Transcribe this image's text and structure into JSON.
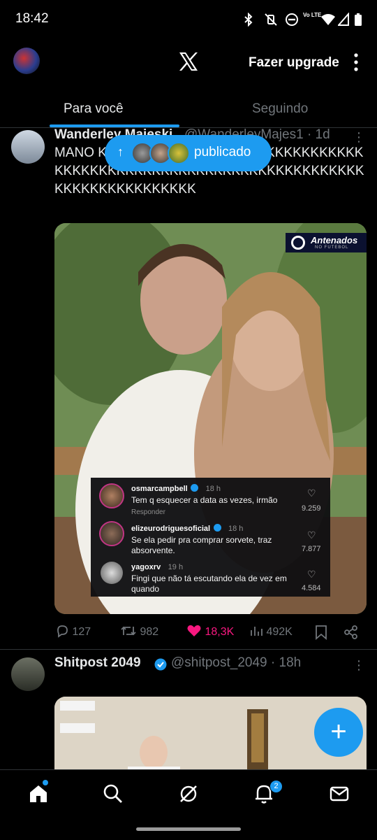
{
  "status_bar": {
    "time": "18:42",
    "network": "Vo LTE"
  },
  "header": {
    "upgrade_label": "Fazer upgrade"
  },
  "tabs": [
    {
      "label": "Para você",
      "active": true
    },
    {
      "label": "Seguindo",
      "active": false
    }
  ],
  "new_posts_pill": {
    "label": "publicado"
  },
  "tweet1": {
    "name": "Wanderley Majeski",
    "handle": "@WanderleyMajes1",
    "time": "· 1d",
    "text": "MANO KKKKKKKKKKKKKKKKKKKKKKKKKKKKKKKKKKKKKKKKKKKKKKKKKKKKKKKKKKKKKKKKKKKKKKKKKKKKKKKKK",
    "media_badge": {
      "brand": "Antenados",
      "subtitle": "NO FUTEBOL"
    },
    "comments": [
      {
        "user": "osmarcampbell",
        "verified": true,
        "time": "18 h",
        "text": "Tem q esquecer a data as vezes, irmão",
        "reply": "Responder",
        "likes": "9.259"
      },
      {
        "user": "elizeurodriguesoficial",
        "verified": true,
        "time": "18 h",
        "text": "Se ela pedir pra comprar sorvete, traz absorvente.",
        "likes": "7.877"
      },
      {
        "user": "yagoxrv",
        "verified": false,
        "time": "19 h",
        "text": "Fingi que não tá escutando ela de vez em quando",
        "likes": "4.584"
      }
    ],
    "actions": {
      "replies": "127",
      "reposts": "982",
      "likes": "18,3K",
      "views": "492K",
      "liked": true
    }
  },
  "tweet2": {
    "name": "Shitpost 2049",
    "handle": "@shitpost_2049",
    "time": "· 18h",
    "verified": true
  },
  "bottom_nav": {
    "notifications_badge": "2"
  },
  "colors": {
    "accent": "#1d9bf0",
    "like": "#f91880",
    "muted": "#71767b",
    "text": "#e7e9ea",
    "background": "#000000"
  }
}
